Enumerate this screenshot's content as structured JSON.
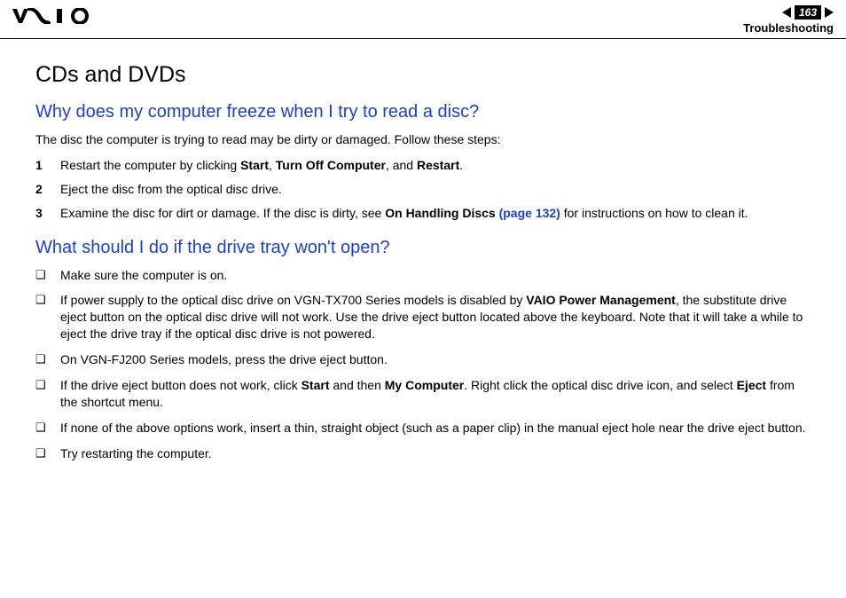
{
  "header": {
    "page_num": "163",
    "section": "Troubleshooting"
  },
  "title": "CDs and DVDs",
  "q1": {
    "heading": "Why does my computer freeze when I try to read a disc?",
    "intro": "The disc the computer is trying to read may be dirty or damaged. Follow these steps:",
    "steps": {
      "s1a": "Restart the computer by clicking ",
      "s1b1": "Start",
      "s1c": ", ",
      "s1b2": "Turn Off Computer",
      "s1d": ", and ",
      "s1b3": "Restart",
      "s1e": ".",
      "s2": "Eject the disc from the optical disc drive.",
      "s3a": "Examine the disc for dirt or damage. If the disc is dirty, see ",
      "s3b": "On Handling Discs ",
      "s3link": "(page 132)",
      "s3c": " for instructions on how to clean it."
    }
  },
  "q2": {
    "heading": "What should I do if the drive tray won't open?",
    "bullets": {
      "b1": "Make sure the computer is on.",
      "b2a": "If power supply to the optical disc drive on VGN-TX700 Series models is disabled by ",
      "b2b": "VAIO Power Management",
      "b2c": ", the substitute drive eject button on the optical disc drive will not work. Use the drive eject button located above the keyboard. Note that it will take a while to eject the drive tray if the optical disc drive is not powered.",
      "b3": "On VGN-FJ200 Series models, press the drive eject button.",
      "b4a": "If the drive eject button does not work, click ",
      "b4b1": "Start",
      "b4c": " and then ",
      "b4b2": "My Computer",
      "b4d": ". Right click the optical disc drive icon, and select ",
      "b4b3": "Eject",
      "b4e": " from the shortcut menu.",
      "b5": "If none of the above options work, insert a thin, straight object (such as a paper clip) in the manual eject hole near the drive eject button.",
      "b6": "Try restarting the computer."
    }
  }
}
